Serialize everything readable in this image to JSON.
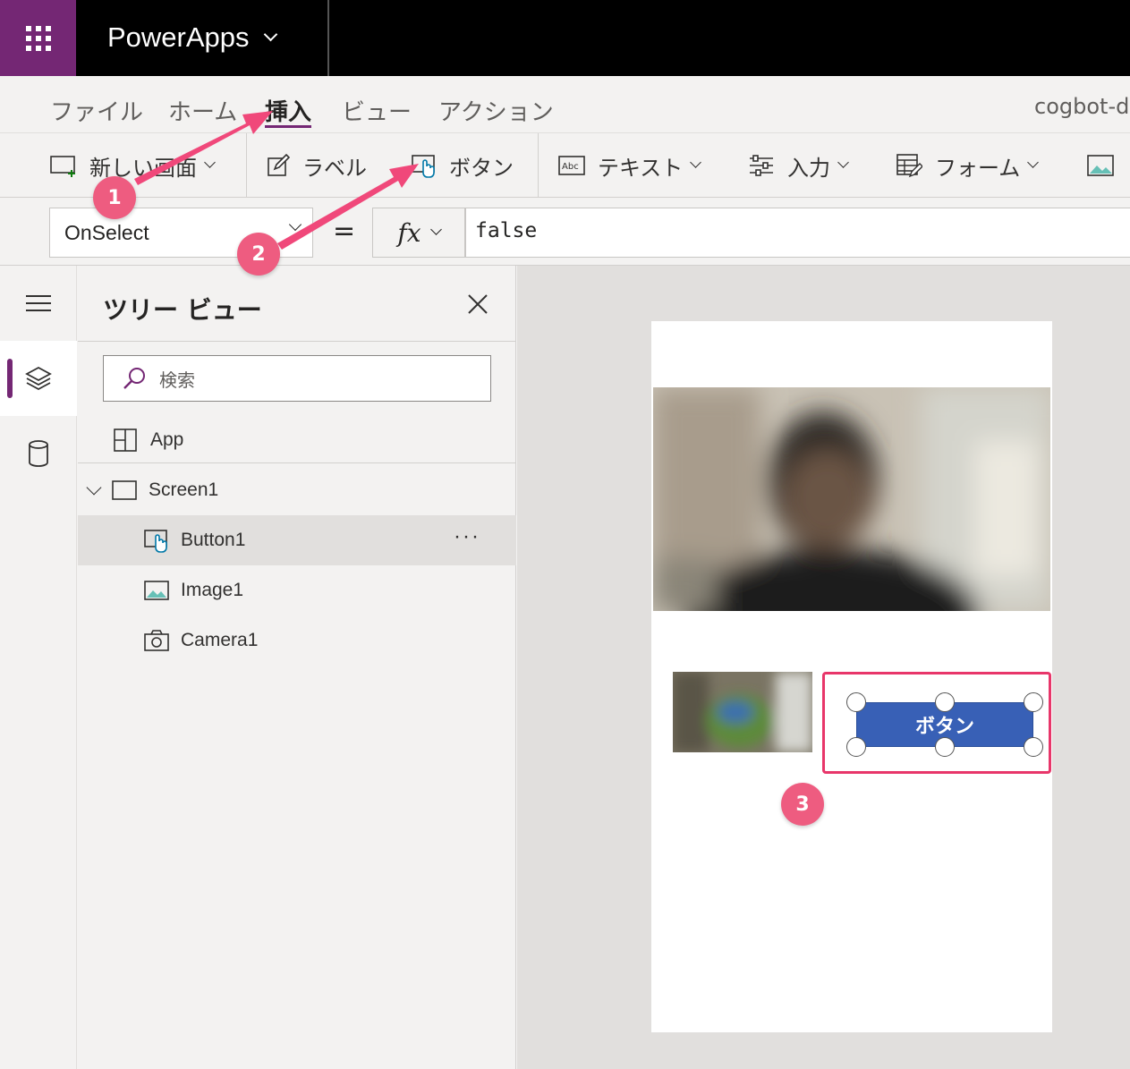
{
  "topbar": {
    "app_title": "PowerApps"
  },
  "menu": {
    "tabs": [
      "ファイル",
      "ホーム",
      "挿入",
      "ビュー",
      "アクション"
    ],
    "active_tab": "挿入",
    "app_name": "cogbot-do"
  },
  "ribbon": {
    "new_screen": "新しい画面",
    "label": "ラベル",
    "button": "ボタン",
    "text": "テキスト",
    "input": "入力",
    "form": "フォーム"
  },
  "formula": {
    "property": "OnSelect",
    "equals": "=",
    "fx": "fx",
    "value": "false"
  },
  "tree": {
    "title": "ツリー ビュー",
    "search_placeholder": "検索",
    "items": [
      {
        "label": "App",
        "icon": "app-icon"
      },
      {
        "label": "Screen1",
        "icon": "screen-icon"
      },
      {
        "label": "Button1",
        "icon": "button-control-icon"
      },
      {
        "label": "Image1",
        "icon": "image-icon"
      },
      {
        "label": "Camera1",
        "icon": "camera-icon"
      }
    ],
    "selected_item": "Button1",
    "more": "···"
  },
  "canvas": {
    "button_text": "ボタン"
  },
  "annotations": [
    "1",
    "2",
    "3"
  ],
  "colors": {
    "brand": "#742774",
    "accent_arrow": "#f0487a",
    "button_fill": "#3860b6",
    "selection": "#e8366a"
  }
}
